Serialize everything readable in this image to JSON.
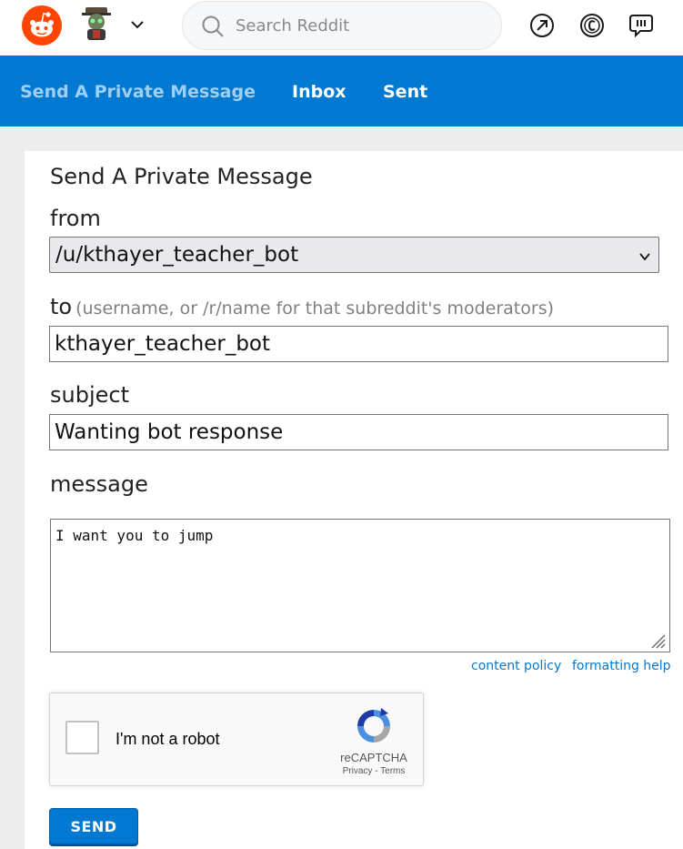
{
  "header": {
    "search_placeholder": "Search Reddit",
    "icons": [
      "reddit-logo-icon",
      "user-avatar-icon",
      "chevron-down-icon",
      "search-icon",
      "popular-arrow-icon",
      "coins-icon",
      "chat-icon"
    ]
  },
  "nav": {
    "items": [
      {
        "label": "Send A Private Message",
        "active": true
      },
      {
        "label": "Inbox",
        "active": false
      },
      {
        "label": "Sent",
        "active": false
      }
    ]
  },
  "form": {
    "title": "Send A Private Message",
    "from_label": "from",
    "from_value": "/u/kthayer_teacher_bot",
    "to_label": "to",
    "to_hint": "(username, or /r/name for that subreddit's moderators)",
    "to_value": "kthayer_teacher_bot",
    "subject_label": "subject",
    "subject_value": "Wanting bot response",
    "message_label": "message",
    "message_value": "I want you to jump",
    "content_policy": "content policy",
    "formatting_help": "formatting help",
    "captcha": {
      "label": "I'm not a robot",
      "brand": "reCAPTCHA",
      "privacy": "Privacy",
      "separator": " - ",
      "terms": "Terms"
    },
    "send_label": "SEND"
  },
  "colors": {
    "reddit_orange": "#ff4500",
    "nav_blue": "#0079d3",
    "nav_active": "#9fd0f3",
    "link_blue": "#0079d3"
  }
}
